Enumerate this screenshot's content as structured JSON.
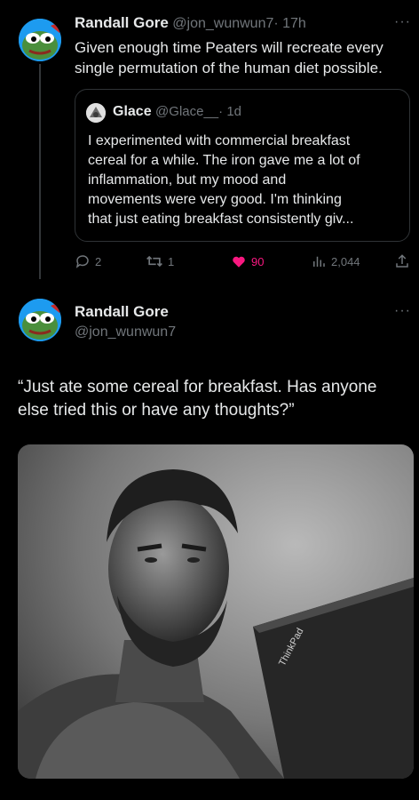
{
  "tweet": {
    "author_name": "Randall Gore",
    "author_handle": "@jon_wunwun7",
    "time": "· 17h",
    "more": "···",
    "text_line1": "Given enough time Peaters will recreate every",
    "text_line2": "single permutation of the human diet possible.",
    "quote": {
      "author_name": "Glace",
      "author_handle": "@Glace__",
      "time": "· 1d",
      "lines": [
        "I experimented with commercial breakfast",
        "cereal for a while. The iron gave me a lot of",
        "inflammation, but my mood and",
        "movements were very good. I'm thinking",
        "that just eating breakfast consistently giv..."
      ]
    },
    "actions": {
      "replies": "2",
      "retweets": "1",
      "likes": "90",
      "views": "2,044"
    }
  },
  "reply": {
    "author_name": "Randall Gore",
    "author_handle": "@jon_wunwun7",
    "more": "···",
    "text_line1": "“Just ate some cereal for breakfast. Has anyone",
    "text_line2": "else tried this or have any thoughts?”",
    "image_laptop_text": "ThinkPad"
  },
  "colors": {
    "like": "#f91880",
    "muted": "#71767b",
    "text": "#e7e9ea"
  }
}
